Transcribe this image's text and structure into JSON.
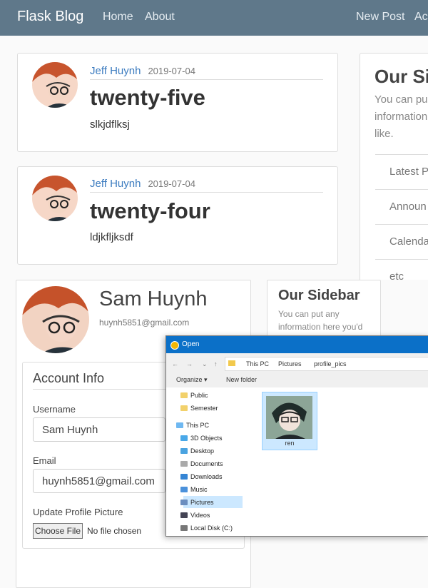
{
  "nav": {
    "brand": "Flask Blog",
    "links": [
      "Home",
      "About",
      "New Post",
      "Ac"
    ]
  },
  "posts": [
    {
      "author": "Jeff Huynh",
      "date": "2019-07-04",
      "title": "twenty-five",
      "body": "slkjdflksj"
    },
    {
      "author": "Jeff Huynh",
      "date": "2019-07-04",
      "title": "twenty-four",
      "body": "ldjkfljksdf"
    }
  ],
  "sidebar_top": {
    "title": "Our Si",
    "text_lines": [
      "You can pu",
      "information",
      "like."
    ],
    "items": [
      "Latest P",
      "Announ",
      "Calenda",
      "etc"
    ]
  },
  "profile": {
    "name": "Sam Huynh",
    "email": "huynh5851@gmail.com",
    "account_heading": "Account Info",
    "username_label": "Username",
    "username_value": "Sam Huynh",
    "email_label": "Email",
    "email_value": "huynh5851@gmail.com",
    "picture_label": "Update Profile Picture",
    "choose_file": "Choose File",
    "no_file": "No file chosen"
  },
  "sidebar_bottom": {
    "title": "Our Sidebar",
    "text_lines": [
      "You can put any",
      "information here you'd"
    ]
  },
  "dialog": {
    "title": "Open",
    "path": [
      "This PC",
      "Pictures",
      "profile_pics"
    ],
    "organize": "Organize ▾",
    "new_folder": "New folder",
    "tree": [
      "Public",
      "Semester",
      "This PC",
      "3D Objects",
      "Desktop",
      "Documents",
      "Downloads",
      "Music",
      "Pictures",
      "Videos",
      "Local Disk (C:)"
    ],
    "file_name": "ren"
  }
}
